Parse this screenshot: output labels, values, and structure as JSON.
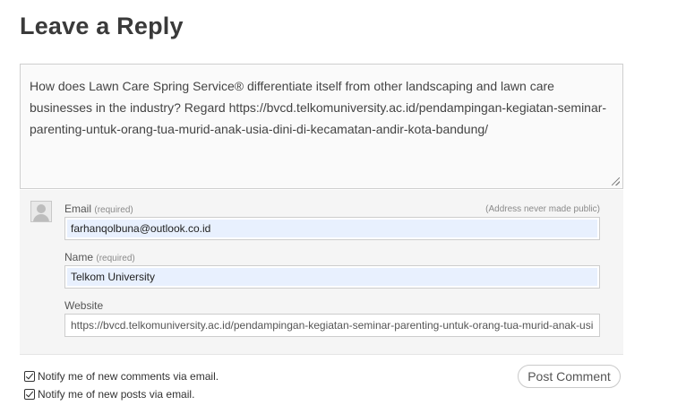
{
  "heading": "Leave a Reply",
  "comment": {
    "text": "How does Lawn Care Spring Service® differentiate itself from other landscaping and lawn care businesses in the industry? Regard https://bvcd.telkomuniversity.ac.id/pendampingan-kegiatan-seminar-parenting-untuk-orang-tua-murid-anak-usia-dini-di-kecamatan-andir-kota-bandung/"
  },
  "identity": {
    "privacy_note": "(Address never made public)",
    "email": {
      "label": "Email",
      "required": "(required)",
      "value": "farhanqolbuna@outlook.co.id"
    },
    "name": {
      "label": "Name",
      "required": "(required)",
      "value": "Telkom University"
    },
    "website": {
      "label": "Website",
      "value": "https://bvcd.telkomuniversity.ac.id/pendampingan-kegiatan-seminar-parenting-untuk-orang-tua-murid-anak-usia-dini-di-kecamatan-andir-kota-bandung/"
    }
  },
  "options": {
    "notify_comments": "Notify me of new comments via email.",
    "notify_posts": "Notify me of new posts via email."
  },
  "post_button": "Post Comment",
  "icons": {
    "avatar": "default-avatar-icon",
    "checkbox": "checkbox-checked-icon"
  }
}
